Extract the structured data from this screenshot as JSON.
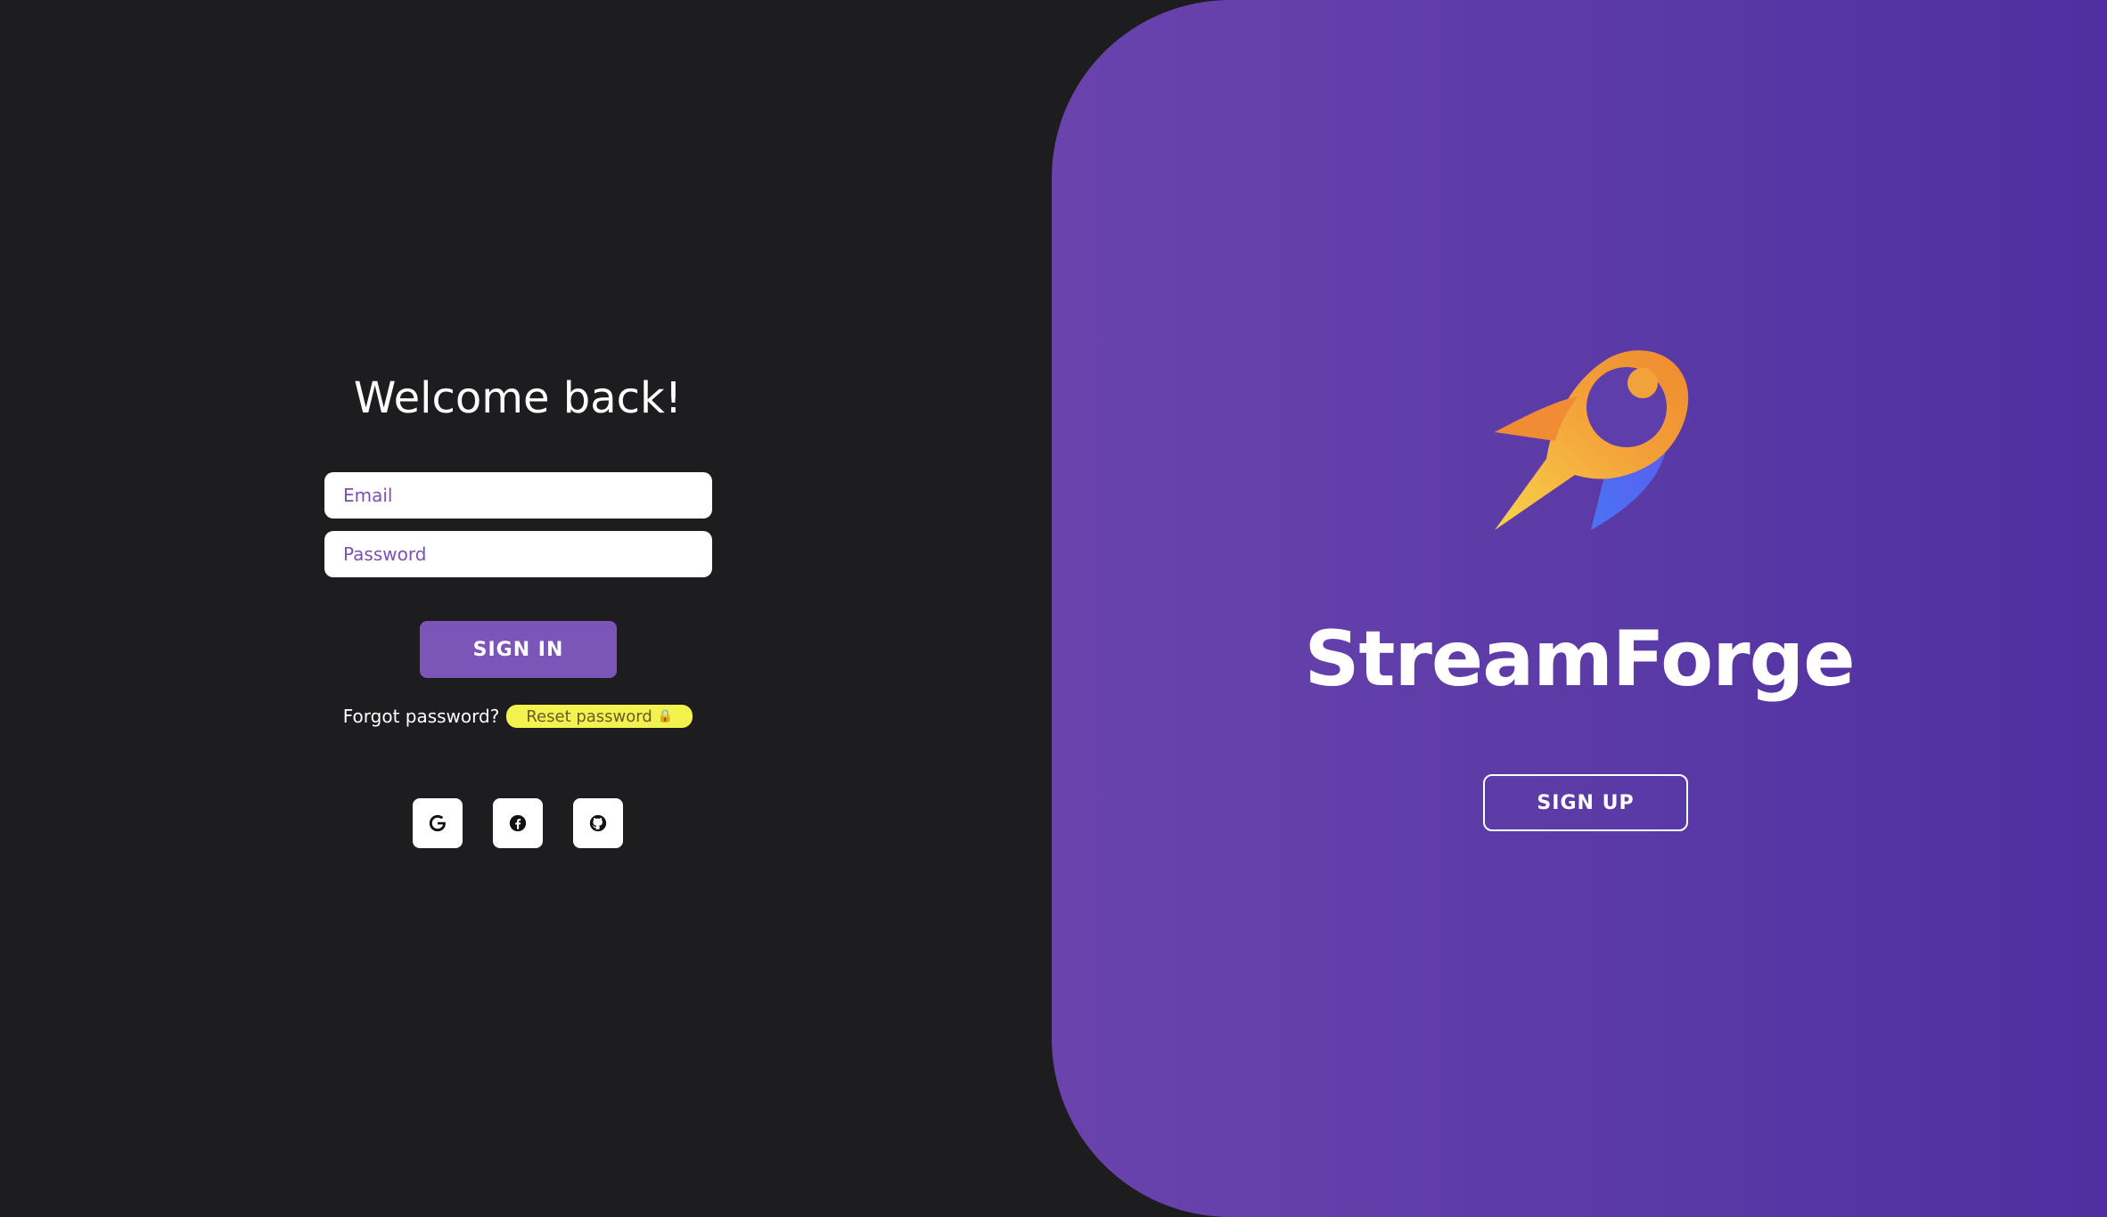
{
  "login": {
    "title": "Welcome back!",
    "email_placeholder": "Email",
    "password_placeholder": "Password",
    "signin_label": "SIGN IN",
    "forgot_text": "Forgot password?",
    "reset_label": "Reset password",
    "reset_icon": "lock-icon",
    "reset_highlight_color": "#f3f24e",
    "social": [
      {
        "name": "google",
        "icon": "google-icon"
      },
      {
        "name": "facebook",
        "icon": "facebook-icon"
      },
      {
        "name": "github",
        "icon": "github-icon"
      }
    ]
  },
  "brand": {
    "name": "StreamForge",
    "logo_icon": "rocket-logo-icon",
    "signup_label": "SIGN UP",
    "accent_color": "#7b55b8",
    "panel_gradient": [
      "#6a43ad",
      "#4f2fa1"
    ]
  }
}
